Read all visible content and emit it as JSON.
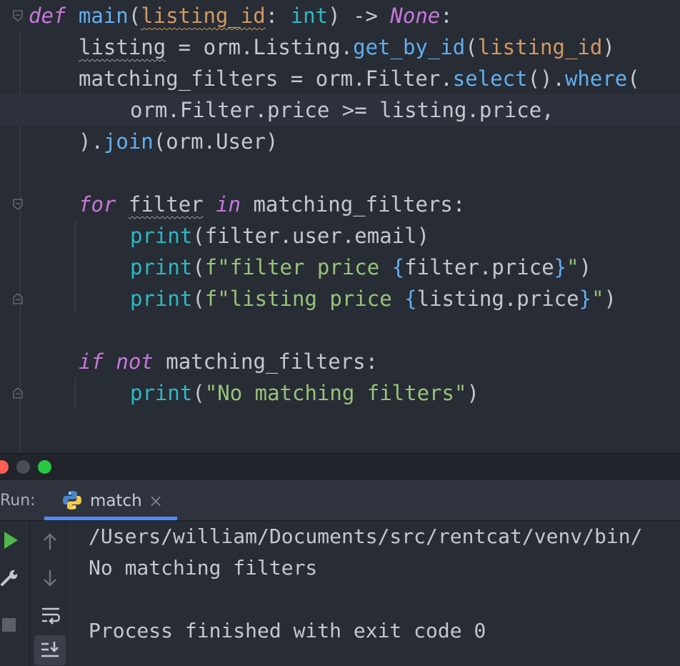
{
  "editor": {
    "lines": [
      {
        "tokens": [
          {
            "t": "def",
            "c": "kw"
          },
          {
            "t": " "
          },
          {
            "t": "main",
            "c": "fn"
          },
          {
            "t": "("
          },
          {
            "t": "listing_id",
            "c": "pm wavy"
          },
          {
            "t": ": "
          },
          {
            "t": "int",
            "c": "bi"
          },
          {
            "t": ") -> "
          },
          {
            "t": "None",
            "c": "nn"
          },
          {
            "t": ":"
          }
        ]
      },
      {
        "tokens": [
          {
            "t": "listing",
            "c": "wavy-w"
          },
          {
            "t": " = orm.Listing."
          },
          {
            "t": "get_by_id",
            "c": "fn"
          },
          {
            "t": "("
          },
          {
            "t": "listing_id",
            "c": "pm"
          },
          {
            "t": ")"
          }
        ]
      },
      {
        "tokens": [
          {
            "t": "matching_filters = orm.Filter."
          },
          {
            "t": "select",
            "c": "fn"
          },
          {
            "t": "()."
          },
          {
            "t": "where",
            "c": "fn"
          },
          {
            "t": "("
          }
        ]
      },
      {
        "tokens": [
          {
            "t": "orm.Filter.price >= listing.price,"
          }
        ]
      },
      {
        "tokens": [
          {
            "t": ")."
          },
          {
            "t": "join",
            "c": "fn"
          },
          {
            "t": "(orm.User)"
          }
        ]
      },
      {
        "tokens": [
          {
            "t": "for",
            "c": "kw"
          },
          {
            "t": " "
          },
          {
            "t": "filter",
            "c": "wavy-w"
          },
          {
            "t": " "
          },
          {
            "t": "in",
            "c": "kw"
          },
          {
            "t": " matching_filters:"
          }
        ]
      },
      {
        "tokens": [
          {
            "t": "print",
            "c": "bi"
          },
          {
            "t": "(filter.user.email)"
          }
        ]
      },
      {
        "tokens": [
          {
            "t": "print",
            "c": "bi"
          },
          {
            "t": "("
          },
          {
            "t": "f\"filter price ",
            "c": "str"
          },
          {
            "t": "{",
            "c": "brace"
          },
          {
            "t": "filter.price"
          },
          {
            "t": "}",
            "c": "brace"
          },
          {
            "t": "\"",
            "c": "str"
          },
          {
            "t": ")"
          }
        ]
      },
      {
        "tokens": [
          {
            "t": "print",
            "c": "bi"
          },
          {
            "t": "("
          },
          {
            "t": "f\"listing price ",
            "c": "str"
          },
          {
            "t": "{",
            "c": "brace"
          },
          {
            "t": "listing.price"
          },
          {
            "t": "}",
            "c": "brace"
          },
          {
            "t": "\"",
            "c": "str"
          },
          {
            "t": ")"
          }
        ]
      },
      {
        "tokens": [
          {
            "t": "if",
            "c": "kw"
          },
          {
            "t": " "
          },
          {
            "t": "not",
            "c": "kw"
          },
          {
            "t": " matching_filters:"
          }
        ]
      },
      {
        "tokens": [
          {
            "t": "print",
            "c": "bi"
          },
          {
            "t": "("
          },
          {
            "t": "\"No matching filters\"",
            "c": "str"
          },
          {
            "t": ")"
          }
        ]
      }
    ]
  },
  "run_panel": {
    "label": "Run:",
    "tab_label": "match",
    "tab_close": "×",
    "icons": [
      "run-icon",
      "wrench-icon",
      "stop-icon",
      "scroll-up-icon",
      "scroll-down-icon",
      "soft-wrap-icon",
      "scroll-to-end-icon",
      "python-icon",
      "close-icon"
    ],
    "output_lines": [
      "/Users/william/Documents/src/rentcat/venv/bin/",
      "No matching filters",
      "",
      "Process finished with exit code 0"
    ]
  },
  "colors": {
    "editor_bg": "#282c34",
    "keyword": "#c678dd",
    "function": "#61afef",
    "builtin": "#2bbac5",
    "parameter": "#d19a66",
    "string": "#98c379",
    "text": "#c3c8d0",
    "accent": "#528bff",
    "traffic_red": "#ff5f57",
    "traffic_gray": "#4a4d53",
    "traffic_green": "#28c840",
    "run_green": "#4fb84a"
  }
}
